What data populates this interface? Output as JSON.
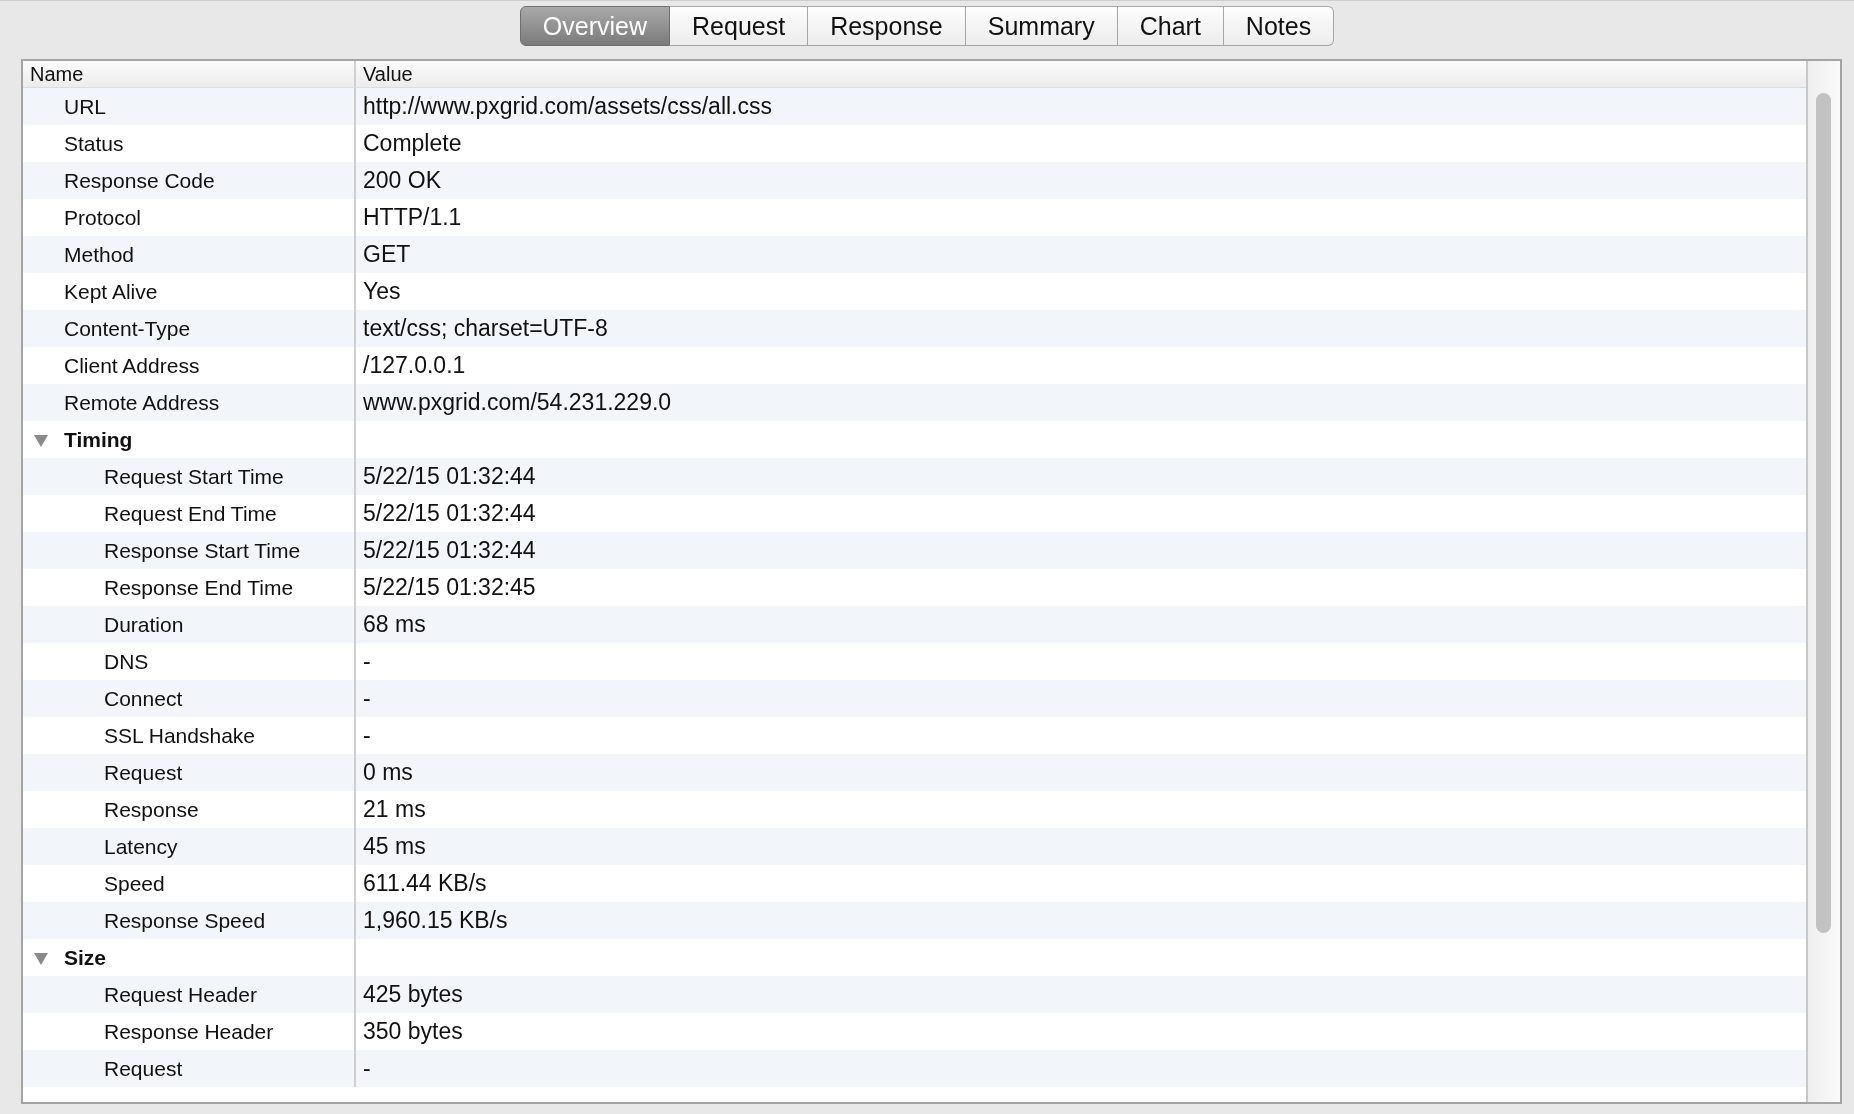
{
  "tabs": [
    {
      "label": "Overview",
      "selected": true
    },
    {
      "label": "Request",
      "selected": false
    },
    {
      "label": "Response",
      "selected": false
    },
    {
      "label": "Summary",
      "selected": false
    },
    {
      "label": "Chart",
      "selected": false
    },
    {
      "label": "Notes",
      "selected": false
    }
  ],
  "table": {
    "columns": [
      "Name",
      "Value"
    ],
    "rows": [
      {
        "name": "URL",
        "value": "http://www.pxgrid.com/assets/css/all.css"
      },
      {
        "name": "Status",
        "value": "Complete"
      },
      {
        "name": "Response Code",
        "value": "200 OK"
      },
      {
        "name": "Protocol",
        "value": "HTTP/1.1"
      },
      {
        "name": "Method",
        "value": "GET"
      },
      {
        "name": "Kept Alive",
        "value": "Yes"
      },
      {
        "name": "Content-Type",
        "value": "text/css; charset=UTF-8"
      },
      {
        "name": "Client Address",
        "value": "/127.0.0.1"
      },
      {
        "name": "Remote Address",
        "value": "www.pxgrid.com/54.231.229.0"
      },
      {
        "name": "Timing",
        "expanded": true,
        "children": [
          {
            "name": "Request Start Time",
            "value": "5/22/15 01:32:44"
          },
          {
            "name": "Request End Time",
            "value": "5/22/15 01:32:44"
          },
          {
            "name": "Response Start Time",
            "value": "5/22/15 01:32:44"
          },
          {
            "name": "Response End Time",
            "value": "5/22/15 01:32:45"
          },
          {
            "name": "Duration",
            "value": "68 ms"
          },
          {
            "name": "DNS",
            "value": "-"
          },
          {
            "name": "Connect",
            "value": "-"
          },
          {
            "name": "SSL Handshake",
            "value": "-"
          },
          {
            "name": "Request",
            "value": "0 ms"
          },
          {
            "name": "Response",
            "value": "21 ms"
          },
          {
            "name": "Latency",
            "value": "45 ms"
          },
          {
            "name": "Speed",
            "value": "611.44 KB/s"
          },
          {
            "name": "Response Speed",
            "value": "1,960.15 KB/s"
          }
        ]
      },
      {
        "name": "Size",
        "expanded": true,
        "children": [
          {
            "name": "Request Header",
            "value": "425 bytes"
          },
          {
            "name": "Response Header",
            "value": "350 bytes"
          },
          {
            "name": "Request",
            "value": "-"
          }
        ]
      }
    ]
  }
}
